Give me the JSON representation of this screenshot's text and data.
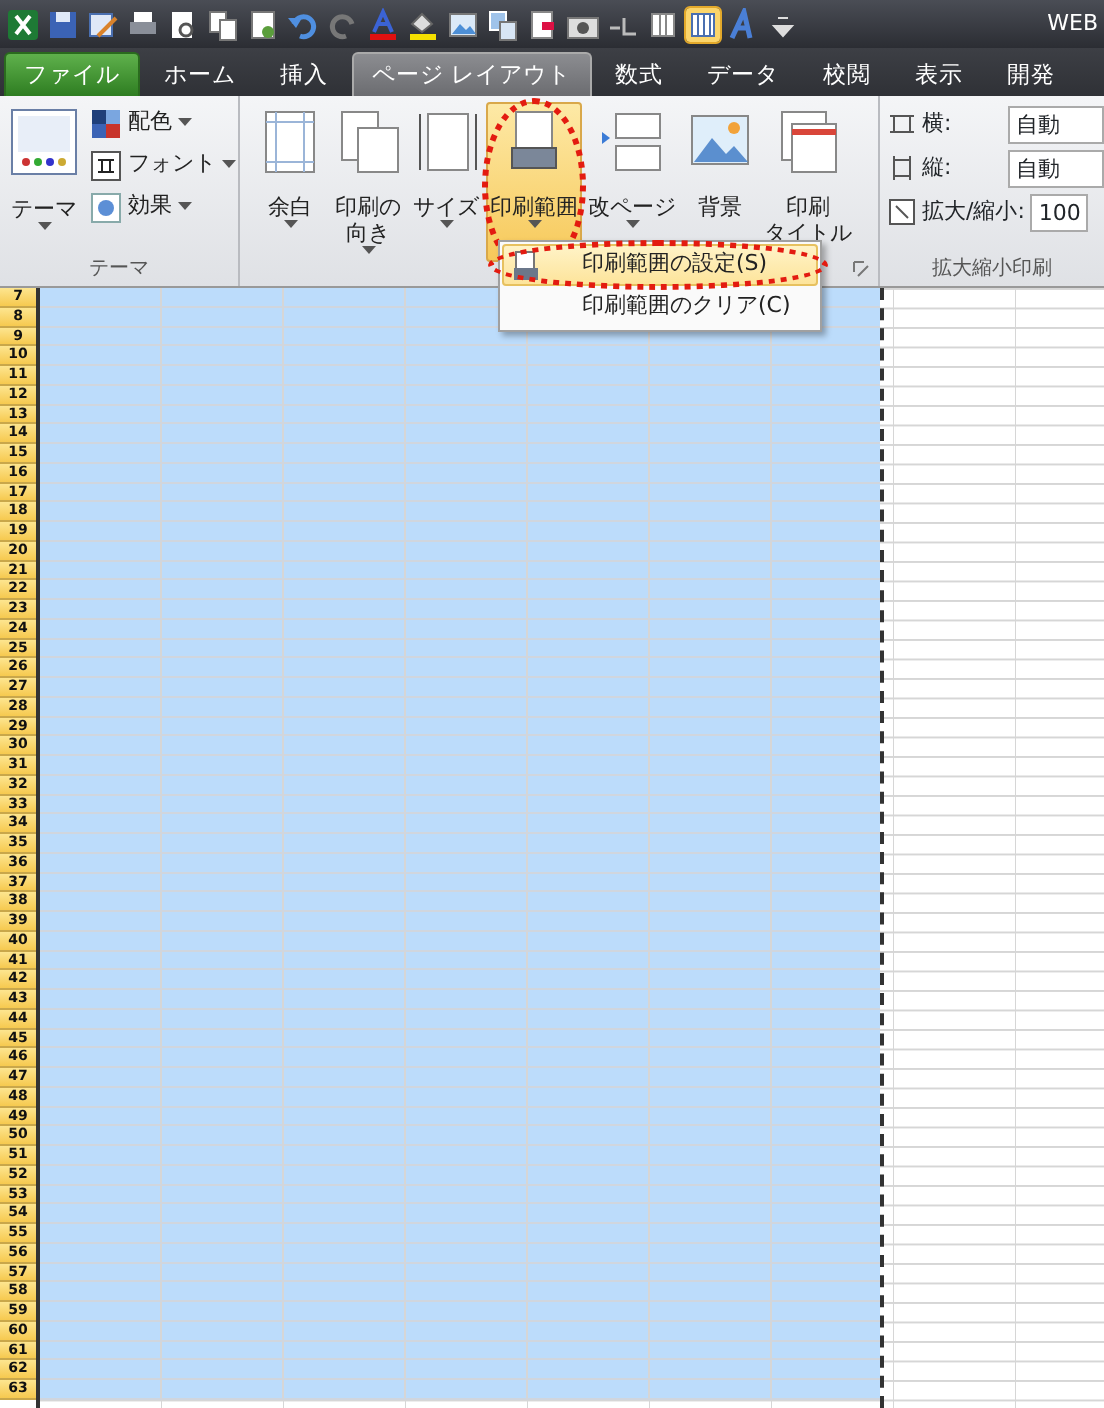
{
  "window": {
    "title": "WEB"
  },
  "quick_access_toolbar": [
    {
      "kind": "logo",
      "selected": false
    },
    {
      "kind": "save",
      "selected": false
    },
    {
      "kind": "edit",
      "selected": false
    },
    {
      "kind": "print",
      "selected": false
    },
    {
      "kind": "preview",
      "selected": false
    },
    {
      "kind": "copy",
      "selected": false
    },
    {
      "kind": "document",
      "selected": false
    },
    {
      "kind": "undo",
      "selected": false
    },
    {
      "kind": "redo",
      "selected": false
    },
    {
      "kind": "font-color",
      "selected": false
    },
    {
      "kind": "fill-color",
      "selected": false
    },
    {
      "kind": "picture",
      "selected": false
    },
    {
      "kind": "shapes",
      "selected": false
    },
    {
      "kind": "attach",
      "selected": false
    },
    {
      "kind": "camera",
      "selected": false
    },
    {
      "kind": "line",
      "selected": false
    },
    {
      "kind": "column",
      "selected": false
    },
    {
      "kind": "columns",
      "selected": true
    },
    {
      "kind": "text-effect",
      "selected": false
    },
    {
      "kind": "customize",
      "selected": false
    }
  ],
  "tabs": [
    {
      "label": "ファイル",
      "kind": "file",
      "selected": false
    },
    {
      "label": "ホーム",
      "kind": "tab",
      "selected": false
    },
    {
      "label": "挿入",
      "kind": "tab",
      "selected": false
    },
    {
      "label": "ページ レイアウト",
      "kind": "tab",
      "selected": true
    },
    {
      "label": "数式",
      "kind": "tab",
      "selected": false
    },
    {
      "label": "データ",
      "kind": "tab",
      "selected": false
    },
    {
      "label": "校閲",
      "kind": "tab",
      "selected": false
    },
    {
      "label": "表示",
      "kind": "tab",
      "selected": false
    },
    {
      "label": "開発",
      "kind": "tab",
      "selected": false
    }
  ],
  "ribbon": {
    "theme_group": {
      "label": "テーマ",
      "big_button": {
        "label": "テーマ"
      },
      "small_buttons": [
        {
          "label": "配色",
          "kind": "colors"
        },
        {
          "label": "フォント",
          "kind": "fonts"
        },
        {
          "label": "効果",
          "kind": "effects"
        }
      ]
    },
    "page_setup_group": {
      "buttons": [
        {
          "lines": [
            "余白"
          ],
          "kind": "margins",
          "active": false,
          "circled": false
        },
        {
          "lines": [
            "印刷の",
            "向き"
          ],
          "kind": "orientation",
          "active": false,
          "circled": false
        },
        {
          "lines": [
            "サイズ"
          ],
          "kind": "size",
          "active": false,
          "circled": false
        },
        {
          "lines": [
            "印刷範囲"
          ],
          "kind": "print-area",
          "active": true,
          "circled": true
        },
        {
          "lines": [
            "改ページ"
          ],
          "kind": "breaks",
          "active": false,
          "circled": false
        },
        {
          "lines": [
            "背景"
          ],
          "kind": "background",
          "active": false,
          "circled": false
        },
        {
          "lines": [
            "印刷",
            "タイトル"
          ],
          "kind": "print-titles",
          "active": false,
          "circled": false
        }
      ]
    },
    "scale_group": {
      "label": "拡大縮小印刷",
      "fields": [
        {
          "kind": "width",
          "label": "横:",
          "value": "自動"
        },
        {
          "kind": "height",
          "label": "縦:",
          "value": "自動"
        },
        {
          "kind": "scale",
          "label": "拡大/縮小:",
          "value": "100"
        }
      ]
    }
  },
  "print_area_menu": {
    "items": [
      {
        "label": "印刷範囲の設定(S)",
        "selected": true,
        "circled": true
      },
      {
        "label": "印刷範囲のクリア(C)",
        "selected": false,
        "circled": false
      }
    ]
  },
  "sheet": {
    "rows": [
      {
        "label": "7",
        "selected": true
      },
      {
        "label": "8",
        "selected": true
      },
      {
        "label": "9",
        "selected": true
      },
      {
        "label": "10",
        "selected": true
      },
      {
        "label": "11",
        "selected": true
      },
      {
        "label": "12",
        "selected": true
      },
      {
        "label": "13",
        "selected": true
      },
      {
        "label": "14",
        "selected": true
      },
      {
        "label": "15",
        "selected": true
      },
      {
        "label": "16",
        "selected": true
      },
      {
        "label": "17",
        "selected": true
      },
      {
        "label": "18",
        "selected": true
      },
      {
        "label": "19",
        "selected": true
      },
      {
        "label": "20",
        "selected": true
      },
      {
        "label": "21",
        "selected": true
      },
      {
        "label": "22",
        "selected": true
      },
      {
        "label": "23",
        "selected": true
      },
      {
        "label": "24",
        "selected": true
      },
      {
        "label": "25",
        "selected": true
      },
      {
        "label": "26",
        "selected": true
      },
      {
        "label": "27",
        "selected": true
      },
      {
        "label": "28",
        "selected": true
      },
      {
        "label": "29",
        "selected": true
      },
      {
        "label": "30",
        "selected": true
      },
      {
        "label": "31",
        "selected": true
      },
      {
        "label": "32",
        "selected": true
      },
      {
        "label": "33",
        "selected": true
      },
      {
        "label": "34",
        "selected": true
      },
      {
        "label": "35",
        "selected": true
      },
      {
        "label": "36",
        "selected": true
      },
      {
        "label": "37",
        "selected": true
      },
      {
        "label": "38",
        "selected": true
      },
      {
        "label": "39",
        "selected": true
      },
      {
        "label": "40",
        "selected": true
      },
      {
        "label": "41",
        "selected": true
      },
      {
        "label": "42",
        "selected": true
      },
      {
        "label": "43",
        "selected": true
      },
      {
        "label": "44",
        "selected": true
      },
      {
        "label": "45",
        "selected": true
      },
      {
        "label": "46",
        "selected": true
      },
      {
        "label": "47",
        "selected": true
      },
      {
        "label": "48",
        "selected": true
      },
      {
        "label": "49",
        "selected": true
      },
      {
        "label": "50",
        "selected": true
      },
      {
        "label": "51",
        "selected": true
      },
      {
        "label": "52",
        "selected": true
      },
      {
        "label": "53",
        "selected": true
      },
      {
        "label": "54",
        "selected": true
      },
      {
        "label": "55",
        "selected": true
      },
      {
        "label": "56",
        "selected": true
      },
      {
        "label": "57",
        "selected": true
      },
      {
        "label": "58",
        "selected": true
      },
      {
        "label": "59",
        "selected": true
      },
      {
        "label": "60",
        "selected": true
      },
      {
        "label": "61",
        "selected": true
      },
      {
        "label": "62",
        "selected": true
      },
      {
        "label": "63",
        "selected": true
      }
    ]
  }
}
